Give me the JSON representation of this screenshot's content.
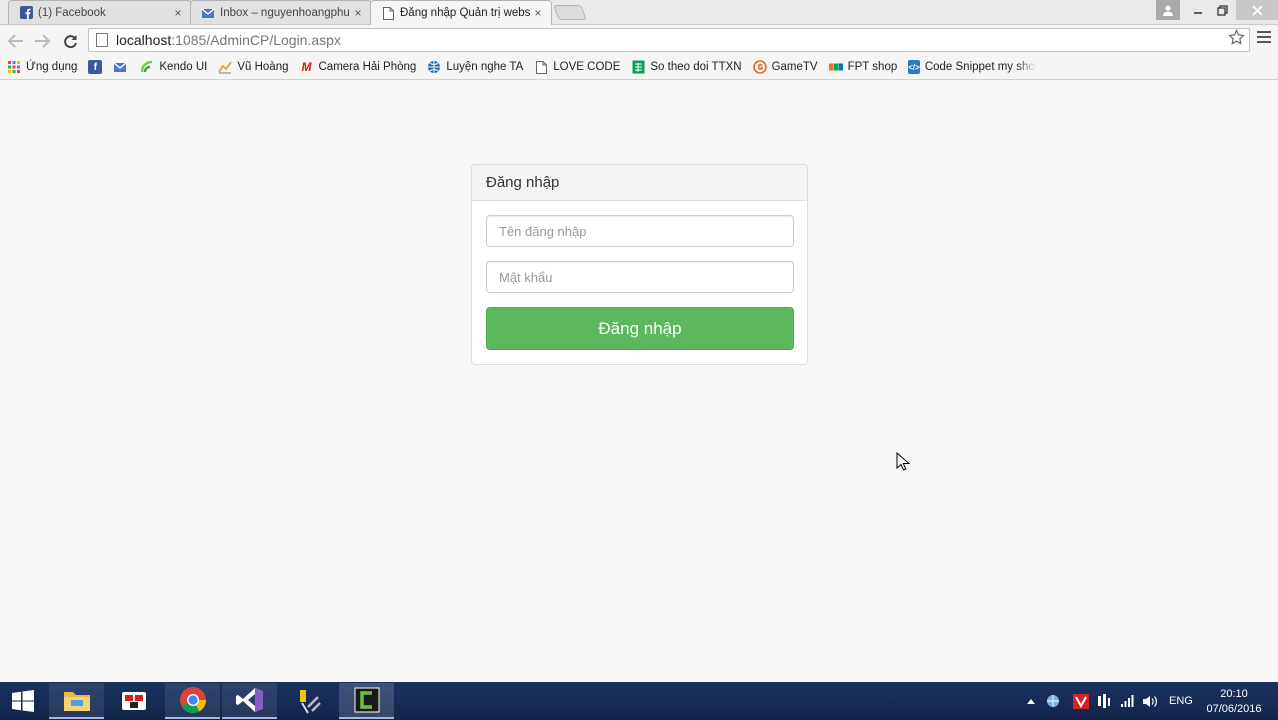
{
  "browser": {
    "tabs": [
      {
        "title": "(1) Facebook",
        "icon": "facebook-icon"
      },
      {
        "title": "Inbox – nguyenhoangphu",
        "icon": "mail-icon"
      },
      {
        "title": "Đăng nhập Quản trị website",
        "icon": "page-icon"
      }
    ],
    "close_glyph": "×",
    "address": {
      "host": "localhost",
      "rest": ":1085/AdminCP/Login.aspx"
    },
    "bookmarks": [
      {
        "label": "Ứng dụng",
        "icon": "apps-grid-icon"
      },
      {
        "label": "",
        "icon": "facebook-icon"
      },
      {
        "label": "",
        "icon": "mail-icon"
      },
      {
        "label": "Kendo UI",
        "icon": "kendo-icon"
      },
      {
        "label": "Vũ Hoàng",
        "icon": "chart-icon"
      },
      {
        "label": "Camera Hải Phòng",
        "icon": "camera-m-icon"
      },
      {
        "label": "Luyện nghe TA",
        "icon": "globe-icon"
      },
      {
        "label": "LOVE CODE",
        "icon": "page-icon"
      },
      {
        "label": "So theo doi TTXN",
        "icon": "sheet-icon"
      },
      {
        "label": "GameTV",
        "icon": "gametv-icon"
      },
      {
        "label": "FPT shop",
        "icon": "fpt-icon"
      },
      {
        "label": "Code Snippet my shop",
        "icon": "code-icon"
      }
    ]
  },
  "login": {
    "heading": "Đăng nhập",
    "username_placeholder": "Tên đăng nhập",
    "password_placeholder": "Mật khẩu",
    "submit_label": "Đăng nhập"
  },
  "taskbar": {
    "language": "ENG",
    "time": "20:10",
    "date": "07/06/2016"
  },
  "colors": {
    "accent": "#5cb85c",
    "page_bg": "#f8f8f8",
    "taskbar": "#13244a"
  }
}
